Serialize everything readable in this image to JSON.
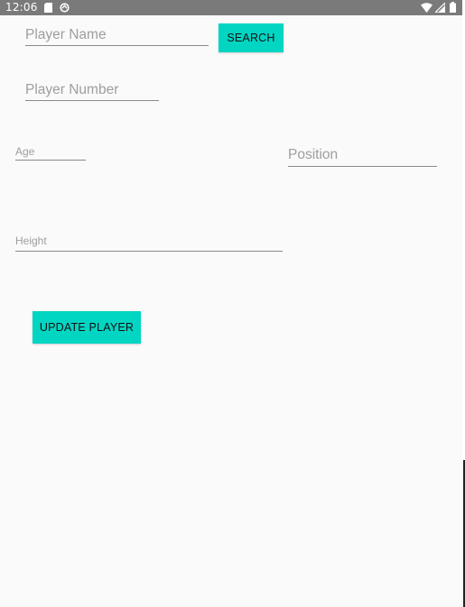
{
  "status_bar": {
    "time": "12:06"
  },
  "form": {
    "player_name": {
      "placeholder": "Player Name",
      "value": ""
    },
    "search_button": {
      "label": "SEARCH"
    },
    "player_number": {
      "placeholder": "Player Number",
      "value": ""
    },
    "age": {
      "placeholder": "Age",
      "value": ""
    },
    "position": {
      "placeholder": "Position",
      "value": ""
    },
    "height": {
      "placeholder": "Height",
      "value": ""
    },
    "update_button": {
      "label": "UPDATE PLAYER"
    }
  },
  "colors": {
    "accent": "#03d5c3",
    "status_bar": "#7a7a7a",
    "background": "#fafafa",
    "hint_text": "#9e9e9e",
    "underline": "#8a8a8a"
  },
  "icons": [
    "sd-card-icon",
    "sync-icon",
    "wifi-icon",
    "signal-icon",
    "battery-icon"
  ]
}
